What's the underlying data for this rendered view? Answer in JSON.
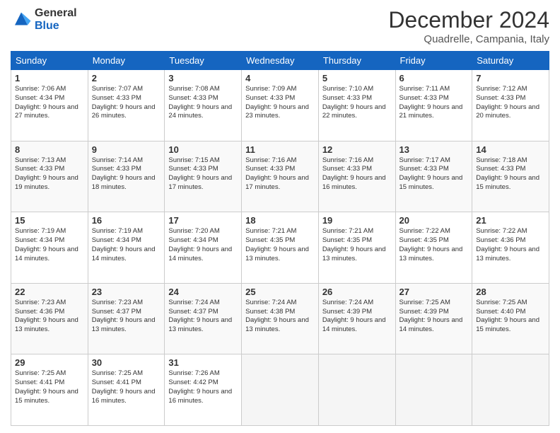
{
  "logo": {
    "general": "General",
    "blue": "Blue"
  },
  "header": {
    "title": "December 2024",
    "subtitle": "Quadrelle, Campania, Italy"
  },
  "weekdays": [
    "Sunday",
    "Monday",
    "Tuesday",
    "Wednesday",
    "Thursday",
    "Friday",
    "Saturday"
  ],
  "weeks": [
    [
      {
        "day": 1,
        "sunrise": "7:06 AM",
        "sunset": "4:34 PM",
        "daylight": "9 hours and 27 minutes."
      },
      {
        "day": 2,
        "sunrise": "7:07 AM",
        "sunset": "4:33 PM",
        "daylight": "9 hours and 26 minutes."
      },
      {
        "day": 3,
        "sunrise": "7:08 AM",
        "sunset": "4:33 PM",
        "daylight": "9 hours and 24 minutes."
      },
      {
        "day": 4,
        "sunrise": "7:09 AM",
        "sunset": "4:33 PM",
        "daylight": "9 hours and 23 minutes."
      },
      {
        "day": 5,
        "sunrise": "7:10 AM",
        "sunset": "4:33 PM",
        "daylight": "9 hours and 22 minutes."
      },
      {
        "day": 6,
        "sunrise": "7:11 AM",
        "sunset": "4:33 PM",
        "daylight": "9 hours and 21 minutes."
      },
      {
        "day": 7,
        "sunrise": "7:12 AM",
        "sunset": "4:33 PM",
        "daylight": "9 hours and 20 minutes."
      }
    ],
    [
      {
        "day": 8,
        "sunrise": "7:13 AM",
        "sunset": "4:33 PM",
        "daylight": "9 hours and 19 minutes."
      },
      {
        "day": 9,
        "sunrise": "7:14 AM",
        "sunset": "4:33 PM",
        "daylight": "9 hours and 18 minutes."
      },
      {
        "day": 10,
        "sunrise": "7:15 AM",
        "sunset": "4:33 PM",
        "daylight": "9 hours and 17 minutes."
      },
      {
        "day": 11,
        "sunrise": "7:16 AM",
        "sunset": "4:33 PM",
        "daylight": "9 hours and 17 minutes."
      },
      {
        "day": 12,
        "sunrise": "7:16 AM",
        "sunset": "4:33 PM",
        "daylight": "9 hours and 16 minutes."
      },
      {
        "day": 13,
        "sunrise": "7:17 AM",
        "sunset": "4:33 PM",
        "daylight": "9 hours and 15 minutes."
      },
      {
        "day": 14,
        "sunrise": "7:18 AM",
        "sunset": "4:33 PM",
        "daylight": "9 hours and 15 minutes."
      }
    ],
    [
      {
        "day": 15,
        "sunrise": "7:19 AM",
        "sunset": "4:34 PM",
        "daylight": "9 hours and 14 minutes."
      },
      {
        "day": 16,
        "sunrise": "7:19 AM",
        "sunset": "4:34 PM",
        "daylight": "9 hours and 14 minutes."
      },
      {
        "day": 17,
        "sunrise": "7:20 AM",
        "sunset": "4:34 PM",
        "daylight": "9 hours and 14 minutes."
      },
      {
        "day": 18,
        "sunrise": "7:21 AM",
        "sunset": "4:35 PM",
        "daylight": "9 hours and 13 minutes."
      },
      {
        "day": 19,
        "sunrise": "7:21 AM",
        "sunset": "4:35 PM",
        "daylight": "9 hours and 13 minutes."
      },
      {
        "day": 20,
        "sunrise": "7:22 AM",
        "sunset": "4:35 PM",
        "daylight": "9 hours and 13 minutes."
      },
      {
        "day": 21,
        "sunrise": "7:22 AM",
        "sunset": "4:36 PM",
        "daylight": "9 hours and 13 minutes."
      }
    ],
    [
      {
        "day": 22,
        "sunrise": "7:23 AM",
        "sunset": "4:36 PM",
        "daylight": "9 hours and 13 minutes."
      },
      {
        "day": 23,
        "sunrise": "7:23 AM",
        "sunset": "4:37 PM",
        "daylight": "9 hours and 13 minutes."
      },
      {
        "day": 24,
        "sunrise": "7:24 AM",
        "sunset": "4:37 PM",
        "daylight": "9 hours and 13 minutes."
      },
      {
        "day": 25,
        "sunrise": "7:24 AM",
        "sunset": "4:38 PM",
        "daylight": "9 hours and 13 minutes."
      },
      {
        "day": 26,
        "sunrise": "7:24 AM",
        "sunset": "4:39 PM",
        "daylight": "9 hours and 14 minutes."
      },
      {
        "day": 27,
        "sunrise": "7:25 AM",
        "sunset": "4:39 PM",
        "daylight": "9 hours and 14 minutes."
      },
      {
        "day": 28,
        "sunrise": "7:25 AM",
        "sunset": "4:40 PM",
        "daylight": "9 hours and 15 minutes."
      }
    ],
    [
      {
        "day": 29,
        "sunrise": "7:25 AM",
        "sunset": "4:41 PM",
        "daylight": "9 hours and 15 minutes."
      },
      {
        "day": 30,
        "sunrise": "7:25 AM",
        "sunset": "4:41 PM",
        "daylight": "9 hours and 16 minutes."
      },
      {
        "day": 31,
        "sunrise": "7:26 AM",
        "sunset": "4:42 PM",
        "daylight": "9 hours and 16 minutes."
      },
      null,
      null,
      null,
      null
    ]
  ],
  "labels": {
    "sunrise": "Sunrise:",
    "sunset": "Sunset:",
    "daylight": "Daylight:"
  }
}
